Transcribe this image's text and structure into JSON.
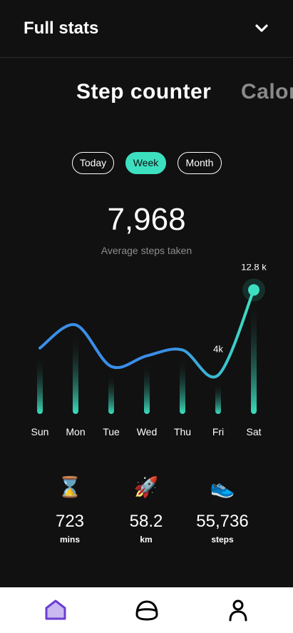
{
  "header": {
    "title": "Full stats",
    "toggle_icon": "chevron-down-icon"
  },
  "tabs": [
    {
      "label": "Step counter",
      "active": true
    },
    {
      "label": "Calories",
      "active": false
    }
  ],
  "range": [
    {
      "label": "Today",
      "active": false
    },
    {
      "label": "Week",
      "active": true
    },
    {
      "label": "Month",
      "active": false
    }
  ],
  "summary": {
    "value": "7,968",
    "caption": "Average steps taken"
  },
  "chart_data": {
    "type": "line",
    "categories": [
      "Sun",
      "Mon",
      "Tue",
      "Wed",
      "Thu",
      "Fri",
      "Sat"
    ],
    "values": [
      6800,
      9200,
      4900,
      6000,
      6600,
      4000,
      12800
    ],
    "annotations": [
      {
        "category": "Fri",
        "label": "4k"
      },
      {
        "category": "Sat",
        "label": "12.8 k"
      }
    ],
    "ylim": [
      0,
      14000
    ],
    "line_color_start": "#3a8fe8",
    "line_color_end": "#3ce0c0"
  },
  "stats": [
    {
      "icon": "hourglass-icon",
      "emoji": "⌛",
      "value": "723",
      "unit": "mins"
    },
    {
      "icon": "rocket-icon",
      "emoji": "🚀",
      "value": "58.2",
      "unit": "km"
    },
    {
      "icon": "sneaker-icon",
      "emoji": "👟",
      "value": "55,736",
      "unit": "steps"
    }
  ],
  "nav": [
    {
      "icon": "home-icon",
      "active": true
    },
    {
      "icon": "helmet-icon",
      "active": false
    },
    {
      "icon": "profile-icon",
      "active": false
    }
  ],
  "colors": {
    "accent": "#3ce0c0",
    "nav_active": "#6a3fd1",
    "background": "#111111"
  }
}
